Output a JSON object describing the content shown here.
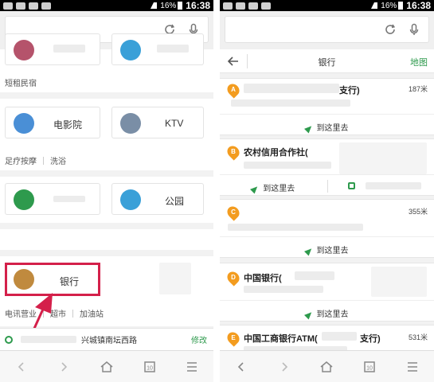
{
  "status": {
    "battery": "16%",
    "time": "16:38"
  },
  "left": {
    "categories": {
      "movie": "电影院",
      "ktv": "KTV",
      "park": "公园",
      "bank": "银行"
    },
    "sublinks": {
      "row1": [
        "短租民宿"
      ],
      "row2": [
        "足疗按摩",
        "洗浴"
      ],
      "row3": [
        "电讯营业",
        "超市",
        "加油站"
      ]
    },
    "address": {
      "text": "兴城镇南坛西路",
      "edit": "修改"
    }
  },
  "right": {
    "header": {
      "title": "银行",
      "map": "地图"
    },
    "results": [
      {
        "marker": "A",
        "name": "支行)",
        "distance": "187米",
        "go": "到这里去"
      },
      {
        "marker": "B",
        "name": "农村信用合作社(",
        "distance": "",
        "go": "到这里去"
      },
      {
        "marker": "C",
        "name": "",
        "distance": "355米",
        "go": "到这里去"
      },
      {
        "marker": "D",
        "name": "中国银行(",
        "distance": "",
        "go": "到这里去"
      },
      {
        "marker": "E",
        "name": "中国工商银行ATM(",
        "name_suffix": "支行)",
        "distance": "531米"
      }
    ]
  },
  "colors": {
    "accent": "#2e9a4d",
    "highlight": "#d4204a",
    "marker": "#f39c1f"
  }
}
